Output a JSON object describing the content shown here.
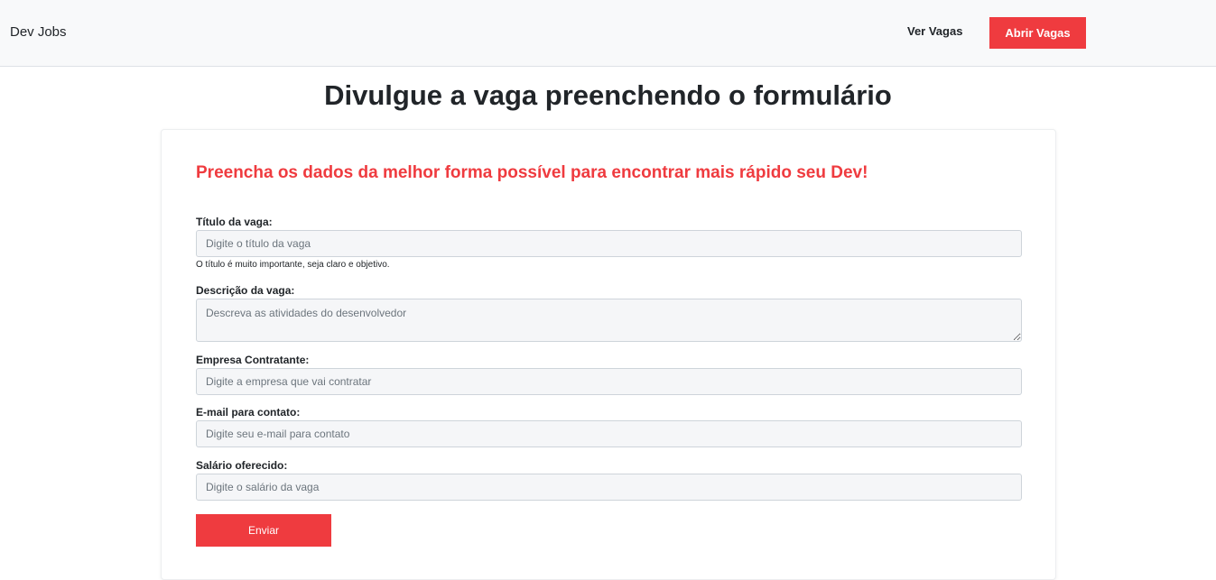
{
  "navbar": {
    "brand": "Dev Jobs",
    "links": [
      "Ver Vagas"
    ],
    "cta_label": "Abrir Vagas"
  },
  "page_title": "Divulgue a vaga preenchendo o formulário",
  "form": {
    "heading": "Preencha os dados da melhor forma possível para encontrar mais rápido seu Dev!",
    "fields": [
      {
        "label": "Título da vaga:",
        "placeholder": "Digite o título da vaga",
        "value": "",
        "help": "O título é muito importante, seja claro e objetivo."
      },
      {
        "label": "Descrição da vaga:",
        "placeholder": "Descreva as atividades do desenvolvedor",
        "value": ""
      },
      {
        "label": "Empresa Contratante:",
        "placeholder": "Digite a empresa que vai contratar",
        "value": ""
      },
      {
        "label": "E-mail para contato:",
        "placeholder": "Digite seu e-mail para contato",
        "value": ""
      },
      {
        "label": "Salário oferecido:",
        "placeholder": "Digite o salário da vaga",
        "value": ""
      }
    ],
    "submit_label": "Enviar"
  },
  "colors": {
    "accent": "#ef3b3f",
    "navbar_bg": "#f8f9fa",
    "input_bg": "#f5f6f8"
  }
}
